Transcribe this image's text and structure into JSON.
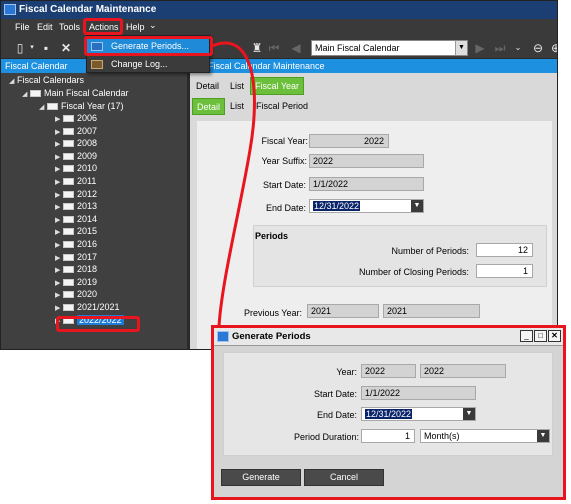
{
  "window": {
    "title": "Fiscal Calendar Maintenance"
  },
  "menubar": {
    "file": "File",
    "edit": "Edit",
    "tools": "Tools",
    "actions": "Actions",
    "help": "Help"
  },
  "toolbar": {
    "fiscal_calendar_value": "Main Fiscal Calendar"
  },
  "panes": {
    "left_title": "Fiscal Calendar",
    "right_title": "Fiscal Calendar Maintenance"
  },
  "actions_menu": {
    "items": [
      {
        "label": "Generate Periods...",
        "icon": "generate-periods-icon"
      },
      {
        "label": "Change Log...",
        "icon": "change-log-icon"
      }
    ]
  },
  "tree": {
    "root": "Fiscal Calendars",
    "calendar": "Main Fiscal Calendar",
    "fiscal_year_group": "Fiscal Year (17)",
    "years": [
      "2006",
      "2007",
      "2008",
      "2009",
      "2010",
      "2011",
      "2012",
      "2013",
      "2014",
      "2015",
      "2016",
      "2017",
      "2018",
      "2019",
      "2020",
      "2021/2021",
      "2022/2022"
    ],
    "selected": "2022/2022"
  },
  "tabs": {
    "row1": [
      "Detail",
      "List",
      "Fiscal Year"
    ],
    "row2": [
      "Detail",
      "List",
      "Fiscal Period"
    ]
  },
  "form": {
    "fiscal_year_label": "Fiscal Year:",
    "fiscal_year": "2022",
    "year_suffix_label": "Year Suffix:",
    "year_suffix": "2022",
    "start_date_label": "Start Date:",
    "start_date": "1/1/2022",
    "end_date_label": "End Date:",
    "end_date": "12/31/2022",
    "periods_header": "Periods",
    "num_periods_label": "Number of Periods:",
    "num_periods": "12",
    "num_closing_label": "Number of Closing Periods:",
    "num_closing": "1",
    "previous_year_label": "Previous Year:",
    "previous_year": "2021",
    "previous_year_suffix": "2021"
  },
  "dialog": {
    "title": "Generate Periods",
    "year_label": "Year:",
    "year": "2022",
    "year_suffix": "2022",
    "start_date_label": "Start Date:",
    "start_date": "1/1/2022",
    "end_date_label": "End Date:",
    "end_date": "12/31/2022",
    "duration_label": "Period Duration:",
    "duration_value": "1",
    "duration_unit": "Month(s)",
    "generate_button": "Generate",
    "cancel_button": "Cancel"
  },
  "colors": {
    "highlight": "#e8141e",
    "accent_blue": "#1e90e0",
    "tab_green": "#6cbf3a"
  }
}
